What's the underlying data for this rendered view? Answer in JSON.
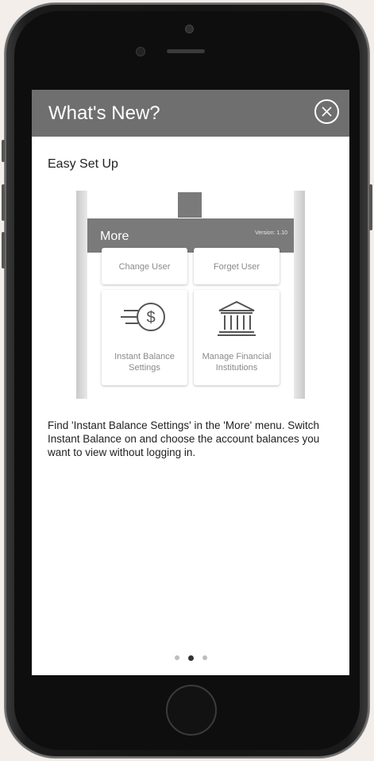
{
  "header": {
    "title": "What's New?",
    "close_icon": "close-icon"
  },
  "content": {
    "subtitle": "Easy Set Up",
    "preview": {
      "title": "More",
      "version": "Version: 1.10",
      "tiles": [
        {
          "label_lines": [
            "Change User"
          ],
          "icon": ""
        },
        {
          "label_lines": [
            "Forget User"
          ],
          "icon": ""
        },
        {
          "label_lines": [
            "Instant Balance",
            "Settings"
          ],
          "icon": "dollar-speed-icon"
        },
        {
          "label_lines": [
            "Manage Financial",
            "Institutions"
          ],
          "icon": "bank-icon"
        }
      ]
    },
    "description": "Find 'Instant Balance Settings' in the 'More' menu. Switch Instant Balance on and choose the account balances you want to view without logging in."
  },
  "pagination": {
    "total": 3,
    "current": 2
  },
  "colors": {
    "header_bg": "#6f6f6f",
    "preview_header_bg": "#7a7a7a",
    "active_dot": "#333333",
    "inactive_dot": "#bdbdbd"
  }
}
